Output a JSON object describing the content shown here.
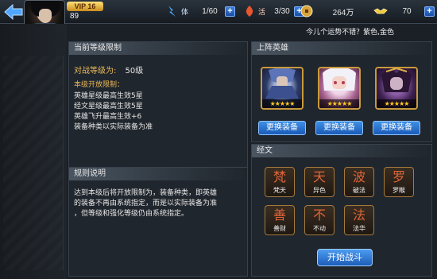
{
  "player": {
    "vip": "VIP 16",
    "level": "89"
  },
  "resources": [
    {
      "icon": "stamina-icon",
      "value": "1/60",
      "has_plus": true
    },
    {
      "icon": "vitality-icon",
      "value": "3/30",
      "has_plus": true
    },
    {
      "icon": "coin-icon",
      "value": "264万",
      "has_plus": false
    },
    {
      "icon": "gold-ingot-icon",
      "value": "70",
      "has_plus": true
    }
  ],
  "resource_labels": {
    "stamina": "体",
    "vitality": "活"
  },
  "fortune": "今儿个运势不错？紫色,金色",
  "level_limit": {
    "header": "当前等级限制",
    "battle_label": "对战等级为:",
    "battle_value": "50级",
    "open_title": "本级开放限制：",
    "rules": [
      "英雄星级最高生效5星",
      "经文星级最高生效5星",
      "英雄飞升最高生效+6",
      "装备种类以实际装备为准"
    ]
  },
  "rules_panel": {
    "header": "规则说明",
    "lines": [
      "达到本级后将开放限制为，装备种类，即英雄",
      "的装备不再由系统指定，而是以实际装备为准",
      "，但等级和强化等级仍由系统指定。"
    ]
  },
  "heroes_panel": {
    "header": "上阵英雄",
    "heroes": [
      {
        "name_icon": "hero-armored-warrior-icon",
        "stars": "★★★★★",
        "button": "更换装备"
      },
      {
        "name_icon": "hero-white-hair-girl-icon",
        "stars": "★★★★★",
        "button": "更换装备"
      },
      {
        "name_icon": "hero-dark-sorceress-icon",
        "stars": "★★★★★",
        "button": "更换装备"
      }
    ]
  },
  "scripture_panel": {
    "header": "经文",
    "items": [
      {
        "glyph": "梵",
        "label": "梵天"
      },
      {
        "glyph": "天",
        "label": "异色"
      },
      {
        "glyph": "波",
        "label": "破法"
      },
      {
        "glyph": "罗",
        "label": "罗睺"
      },
      {
        "glyph": "善",
        "label": "善财"
      },
      {
        "glyph": "不",
        "label": "不动"
      },
      {
        "glyph": "法",
        "label": "法华"
      }
    ]
  },
  "start_button": "开始战斗",
  "colors": {
    "accent_blue": "#2f7fdc",
    "gold": "#e8b85a",
    "star": "#ffc81e"
  }
}
